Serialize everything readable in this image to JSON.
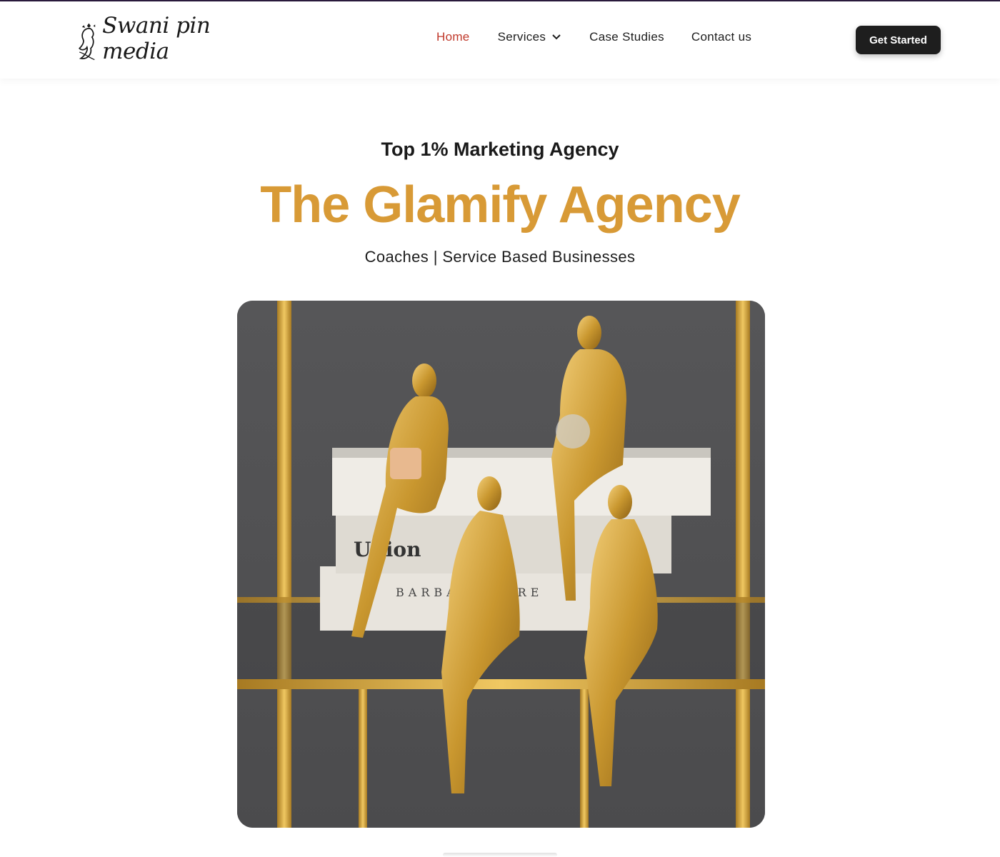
{
  "brand": {
    "logo_text": "Swani pin media",
    "logo_icon": "woman-silhouette-logo-icon"
  },
  "nav": {
    "items": [
      {
        "label": "Home",
        "active": true
      },
      {
        "label": "Services",
        "has_dropdown": true,
        "dropdown_icon": "chevron-down-icon"
      },
      {
        "label": "Case Studies"
      },
      {
        "label": "Contact us"
      }
    ],
    "cta_label": "Get Started"
  },
  "hero": {
    "eyebrow": "Top 1% Marketing Agency",
    "title": "The Glamify Agency",
    "subtitle": "Coaches | Service Based Businesses",
    "image_book_text": [
      "Union",
      "BARBARA BARE"
    ]
  },
  "colors": {
    "accent_gold": "#d89a36",
    "active_nav": "#c0392b",
    "cta_bg": "#1e1e1e",
    "text": "#1b1b1b",
    "top_bar": "#2a1a3c"
  }
}
